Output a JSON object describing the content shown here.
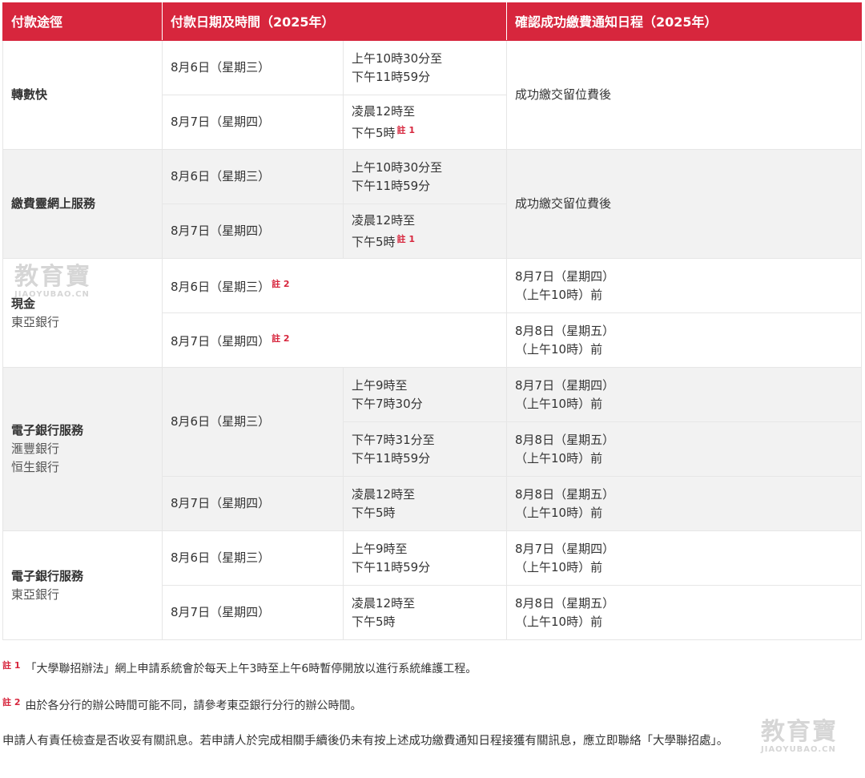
{
  "header": {
    "col1": "付款途徑",
    "col2": "付款日期及時間（2025年）",
    "col3": "確認成功繳費通知日程（2025年）"
  },
  "sections": [
    {
      "title": "轉數快",
      "subtitle": [],
      "confirm": "成功繳交留位費後",
      "rows": [
        {
          "date": "8月6日（星期三）",
          "time1": "上午10時30分至",
          "time2": "下午11時59分",
          "note": ""
        },
        {
          "date": "8月7日（星期四）",
          "time1": "凌晨12時至",
          "time2": "下午5時",
          "note": "註 1"
        }
      ]
    },
    {
      "title": "繳費靈網上服務",
      "subtitle": [],
      "confirm": "成功繳交留位費後",
      "rows": [
        {
          "date": "8月6日（星期三）",
          "time1": "上午10時30分至",
          "time2": "下午11時59分",
          "note": ""
        },
        {
          "date": "8月7日（星期四）",
          "time1": "凌晨12時至",
          "time2": "下午5時",
          "note": "註 1"
        }
      ]
    },
    {
      "title": "現金",
      "subtitle": [
        "東亞銀行"
      ],
      "rows": [
        {
          "date": "8月6日（星期三）",
          "note": "註 2",
          "confirm1": "8月7日（星期四）",
          "confirm2": "（上午10時）前"
        },
        {
          "date": "8月7日（星期四）",
          "note": "註 2",
          "confirm1": "8月8日（星期五）",
          "confirm2": "（上午10時）前"
        }
      ]
    },
    {
      "title": "電子銀行服務",
      "subtitle": [
        "滙豐銀行",
        "恒生銀行"
      ],
      "rows": [
        {
          "date": "8月6日（星期三）",
          "time1": "上午9時至",
          "time2": "下午7時30分",
          "confirm1": "8月7日（星期四）",
          "confirm2": "（上午10時）前"
        },
        {
          "time1": "下午7時31分至",
          "time2": "下午11時59分",
          "confirm1": "8月8日（星期五）",
          "confirm2": "（上午10時）前"
        },
        {
          "date": "8月7日（星期四）",
          "time1": "凌晨12時至",
          "time2": "下午5時",
          "confirm1": "8月8日（星期五）",
          "confirm2": "（上午10時）前"
        }
      ]
    },
    {
      "title": "電子銀行服務",
      "subtitle": [
        "東亞銀行"
      ],
      "rows": [
        {
          "date": "8月6日（星期三）",
          "time1": "上午9時至",
          "time2": "下午11時59分",
          "confirm1": "8月7日（星期四）",
          "confirm2": "（上午10時）前"
        },
        {
          "date": "8月7日（星期四）",
          "time1": "凌晨12時至",
          "time2": "下午5時",
          "confirm1": "8月8日（星期五）",
          "confirm2": "（上午10時）前"
        }
      ]
    }
  ],
  "notes": [
    {
      "label": "註 1",
      "text": "「大學聯招辦法」網上申請系統會於每天上午3時至上午6時暫停開放以進行系統維護工程。"
    },
    {
      "label": "註 2",
      "text": "由於各分行的辦公時間可能不同，請參考東亞銀行分行的辦公時間。"
    }
  ],
  "footer_text": "申請人有責任檢查是否收妥有關訊息。若申請人於完成相關手續後仍未有按上述成功繳費通知日程接獲有關訊息，應立即聯絡「大學聯招處」。",
  "watermark": {
    "big": "教育寶",
    "small": "JIAOYUBAO.CN"
  },
  "colors": {
    "accent": "#d7263d",
    "header_text": "#ffffff",
    "shaded_row": "#f2f2f2"
  }
}
